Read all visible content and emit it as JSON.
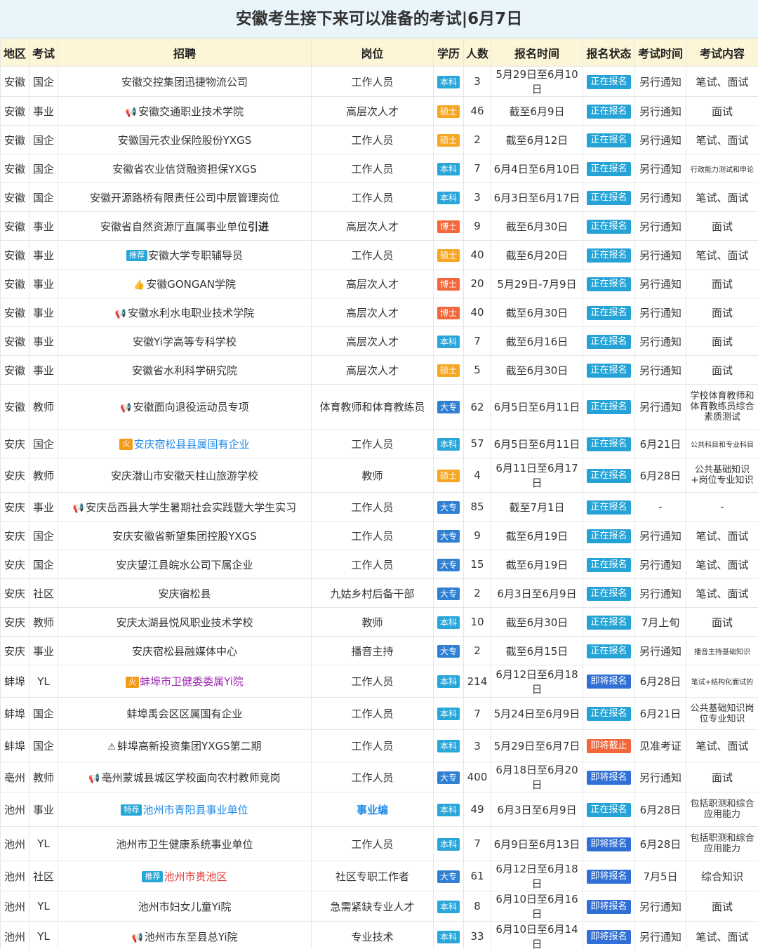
{
  "title": "安徽考生接下来可以准备的考试|6月7日",
  "headers": [
    "地区",
    "考试",
    "招聘",
    "岗位",
    "学历",
    "人数",
    "报名时间",
    "报名状态",
    "考试时间",
    "考试内容"
  ],
  "colors": {
    "edu": {
      "本科": "#29a6d9",
      "硕士": "#f5a623",
      "博士": "#f2663a",
      "大专": "#2f7fd3"
    },
    "status": {
      "正在报名": "#25a3d6",
      "即将报名": "#2f6fd6",
      "即将截止": "#f2663a"
    },
    "tag": {
      "推荐": "#29a6d9",
      "特荐": "#29a6d9",
      "火": "#f59a1a"
    }
  },
  "rows": [
    {
      "region": "安徽",
      "type": "国企",
      "org": "安徽交控集团迅捷物流公司",
      "pos": "工作人员",
      "edu": "本科",
      "num": "3",
      "time": "5月29日至6月10日",
      "status": "正在报名",
      "exam": "另行通知",
      "content": "笔试、面试"
    },
    {
      "region": "安徽",
      "type": "事业",
      "icon": "megaphone-icon",
      "org": "安徽交通职业技术学院",
      "pos": "高层次人才",
      "edu": "硕士",
      "num": "46",
      "time": "截至6月9日",
      "status": "正在报名",
      "exam": "另行通知",
      "content": "面试"
    },
    {
      "region": "安徽",
      "type": "国企",
      "org": "安徽国元农业保险股份YXGS",
      "pos": "工作人员",
      "edu": "硕士",
      "num": "2",
      "time": "截至6月12日",
      "status": "正在报名",
      "exam": "另行通知",
      "content": "笔试、面试"
    },
    {
      "region": "安徽",
      "type": "国企",
      "org": "安徽省农业信贷融资担保YXGS",
      "pos": "工作人员",
      "edu": "本科",
      "num": "7",
      "time": "6月4日至6月10日",
      "status": "正在报名",
      "exam": "另行通知",
      "content": "行政能力测试和申论",
      "content_style": "small"
    },
    {
      "region": "安徽",
      "type": "国企",
      "org": "安徽开源路桥有限责任公司中层管理岗位",
      "pos": "工作人员",
      "edu": "本科",
      "num": "3",
      "time": "6月3日至6月17日",
      "status": "正在报名",
      "exam": "另行通知",
      "content": "笔试、面试"
    },
    {
      "region": "安徽",
      "type": "事业",
      "org": "安徽省自然资源厅直属事业单位",
      "org_suffix": "引进",
      "pos": "高层次人才",
      "edu": "博士",
      "num": "9",
      "time": "截至6月30日",
      "status": "正在报名",
      "exam": "另行通知",
      "content": "面试"
    },
    {
      "region": "安徽",
      "type": "事业",
      "tag": "推荐",
      "org": "安徽大学专职辅导员",
      "pos": "工作人员",
      "edu": "硕士",
      "num": "40",
      "time": "截至6月20日",
      "status": "正在报名",
      "exam": "另行通知",
      "content": "笔试、面试"
    },
    {
      "region": "安徽",
      "type": "事业",
      "icon": "thumbs-up-icon",
      "org": "安徽GONGAN学院",
      "pos": "高层次人才",
      "edu": "博士",
      "num": "20",
      "time": "5月29日-7月9日",
      "status": "正在报名",
      "exam": "另行通知",
      "content": "面试"
    },
    {
      "region": "安徽",
      "type": "事业",
      "icon": "megaphone-icon",
      "org": "安徽水利水电职业技术学院",
      "pos": "高层次人才",
      "edu": "博士",
      "num": "40",
      "time": "截至6月30日",
      "status": "正在报名",
      "exam": "另行通知",
      "content": "面试"
    },
    {
      "region": "安徽",
      "type": "事业",
      "org": "安徽Yi学高等专科学校",
      "pos": "高层次人才",
      "edu": "本科",
      "num": "7",
      "time": "截至6月16日",
      "status": "正在报名",
      "exam": "另行通知",
      "content": "面试"
    },
    {
      "region": "安徽",
      "type": "事业",
      "org": "安徽省水利科学研究院",
      "pos": "高层次人才",
      "edu": "硕士",
      "num": "5",
      "time": "截至6月30日",
      "status": "正在报名",
      "exam": "另行通知",
      "content": "面试"
    },
    {
      "region": "安徽",
      "type": "教师",
      "icon": "megaphone-icon",
      "org": "安徽面向退役运动员专项",
      "pos": "体育教师和体育教练员",
      "edu": "大专",
      "num": "62",
      "time": "6月5日至6月11日",
      "status": "正在报名",
      "exam": "另行通知",
      "content": "学校体育教师和体育教练员综合素质测试",
      "content_style": "multi",
      "row_class": "tall"
    },
    {
      "region": "安庆",
      "type": "国企",
      "tag": "火",
      "org": "安庆宿松县县属国有企业",
      "org_color": "org-blue",
      "pos": "工作人员",
      "edu": "本科",
      "num": "57",
      "time": "6月5日至6月11日",
      "status": "正在报名",
      "exam": "6月21日",
      "content": "公共科目和专业科目",
      "content_style": "small"
    },
    {
      "region": "安庆",
      "type": "教师",
      "org": "安庆潜山市安徽天柱山旅游学校",
      "pos": "教师",
      "edu": "硕士",
      "num": "4",
      "time": "6月11日至6月17日",
      "status": "正在报名",
      "exam": "6月28日",
      "content": "公共基础知识+岗位专业知识",
      "content_style": "multi",
      "row_class": "mid2"
    },
    {
      "region": "安庆",
      "type": "事业",
      "icon": "megaphone-icon",
      "org": "安庆岳西县大学生暑期社会实践暨大学生实习",
      "pos": "工作人员",
      "edu": "大专",
      "num": "85",
      "time": "截至7月1日",
      "status": "正在报名",
      "exam": "-",
      "content": "-"
    },
    {
      "region": "安庆",
      "type": "国企",
      "org": "安庆安徽省新望集团控股YXGS",
      "pos": "工作人员",
      "edu": "大专",
      "num": "9",
      "time": "截至6月19日",
      "status": "正在报名",
      "exam": "另行通知",
      "content": "笔试、面试"
    },
    {
      "region": "安庆",
      "type": "国企",
      "org": "安庆望江县皖水公司下属企业",
      "pos": "工作人员",
      "edu": "大专",
      "num": "15",
      "time": "截至6月19日",
      "status": "正在报名",
      "exam": "另行通知",
      "content": "笔试、面试"
    },
    {
      "region": "安庆",
      "type": "社区",
      "org": "安庆宿松县",
      "pos": "九姑乡村后备干部",
      "edu": "大专",
      "num": "2",
      "time": "6月3日至6月9日",
      "status": "正在报名",
      "exam": "另行通知",
      "content": "笔试、面试"
    },
    {
      "region": "安庆",
      "type": "教师",
      "org": "安庆太湖县悦风职业技术学校",
      "pos": "教师",
      "edu": "本科",
      "num": "10",
      "time": "截至6月30日",
      "status": "正在报名",
      "exam": "7月上旬",
      "content": "面试"
    },
    {
      "region": "安庆",
      "type": "事业",
      "org": "安庆宿松县融媒体中心",
      "pos": "播音主持",
      "edu": "大专",
      "num": "2",
      "time": "截至6月15日",
      "status": "正在报名",
      "exam": "另行通知",
      "content": "播音主持基础知识",
      "content_style": "small"
    },
    {
      "region": "蚌埠",
      "type": "YL",
      "tag": "火",
      "org": "蚌埠市卫健委委属Yi院",
      "org_color": "org-purple",
      "pos": "工作人员",
      "edu": "本科",
      "num": "214",
      "time": "6月12日至6月18日",
      "status": "即将报名",
      "exam": "6月28日",
      "content": "笔试+结构化面试的",
      "content_style": "small",
      "row_class": "mid"
    },
    {
      "region": "蚌埠",
      "type": "国企",
      "org": "蚌埠禹会区区属国有企业",
      "pos": "工作人员",
      "edu": "本科",
      "num": "7",
      "time": "5月24日至6月9日",
      "status": "正在报名",
      "exam": "6月21日",
      "content": "公共基础知识岗位专业知识",
      "content_style": "multi",
      "row_class": "mid"
    },
    {
      "region": "蚌埠",
      "type": "国企",
      "icon": "warning-icon",
      "org": "蚌埠高新投资集团YXGS第二期",
      "pos": "工作人员",
      "edu": "本科",
      "num": "3",
      "time": "5月29日至6月7日",
      "status": "即将截止",
      "exam": "见准考证",
      "content": "笔试、面试",
      "row_class": "mid"
    },
    {
      "region": "亳州",
      "type": "教师",
      "icon": "megaphone-icon",
      "org": "亳州蒙城县城区学校面向农村教师竞岗",
      "pos": "工作人员",
      "edu": "大专",
      "num": "400",
      "time": "6月18日至6月20日",
      "status": "即将报名",
      "exam": "另行通知",
      "content": "面试"
    },
    {
      "region": "池州",
      "type": "事业",
      "tag": "特荐",
      "org": "池州市青阳县事业单位",
      "org_color": "org-blue",
      "pos": "事业编",
      "pos_style": "bold org-blue",
      "edu": "本科",
      "num": "49",
      "time": "6月3日至6月9日",
      "status": "正在报名",
      "exam": "6月28日",
      "content": "包括职测和综合应用能力",
      "content_style": "multi",
      "row_class": "mid2"
    },
    {
      "region": "池州",
      "type": "YL",
      "org": "池州市卫生健康系统事业单位",
      "pos": "工作人员",
      "edu": "本科",
      "num": "7",
      "time": "6月9日至6月13日",
      "status": "即将报名",
      "exam": "6月28日",
      "content": "包括职测和综合应用能力",
      "content_style": "multi",
      "row_class": "mid2"
    },
    {
      "region": "池州",
      "type": "社区",
      "tag": "推荐",
      "org": "池州市贵池区",
      "org_color": "org-red",
      "pos": "社区专职工作者",
      "edu": "大专",
      "num": "61",
      "time": "6月12日至6月18日",
      "status": "即将报名",
      "exam": "7月5日",
      "content": "综合知识"
    },
    {
      "region": "池州",
      "type": "YL",
      "org": "池州市妇女儿童Yi院",
      "pos": "急需紧缺专业人才",
      "edu": "本科",
      "num": "8",
      "time": "6月10日至6月16日",
      "status": "即将报名",
      "exam": "另行通知",
      "content": "面试"
    },
    {
      "region": "池州",
      "type": "YL",
      "icon": "megaphone-icon",
      "org": "池州市东至县总Yi院",
      "pos": "专业技术",
      "edu": "本科",
      "num": "33",
      "time": "6月10日至6月14日",
      "status": "即将报名",
      "exam": "另行通知",
      "content": "笔试、面试"
    }
  ]
}
